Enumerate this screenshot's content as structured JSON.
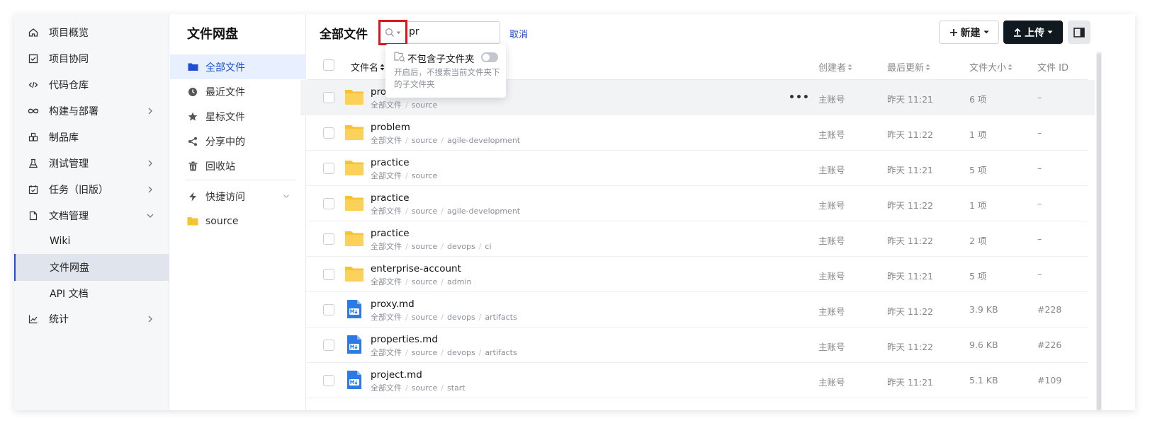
{
  "nav": {
    "items": [
      {
        "label": "项目概览",
        "icon": "home-icon"
      },
      {
        "label": "项目协同",
        "icon": "checkbox-icon"
      },
      {
        "label": "代码仓库",
        "icon": "code-icon"
      },
      {
        "label": "构建与部署",
        "icon": "infinity-icon",
        "has_children": true
      },
      {
        "label": "制品库",
        "icon": "package-icon"
      },
      {
        "label": "测试管理",
        "icon": "flask-icon",
        "has_children": true
      },
      {
        "label": "任务（旧版）",
        "icon": "calendar-check-icon",
        "has_children": true
      },
      {
        "label": "文档管理",
        "icon": "document-icon",
        "expanded": true
      },
      {
        "label": "Wiki",
        "sub": true
      },
      {
        "label": "文件网盘",
        "sub": true,
        "active": true
      },
      {
        "label": "API 文档",
        "sub": true
      },
      {
        "label": "统计",
        "icon": "chart-icon",
        "has_children": true
      }
    ]
  },
  "file_panel": {
    "title": "文件网盘",
    "items": [
      {
        "label": "全部文件",
        "icon": "folder-icon",
        "active": true
      },
      {
        "label": "最近文件",
        "icon": "clock-icon"
      },
      {
        "label": "星标文件",
        "icon": "star-icon"
      },
      {
        "label": "分享中的",
        "icon": "share-icon"
      },
      {
        "label": "回收站",
        "icon": "trash-icon"
      }
    ],
    "quick_access_label": "快捷访问",
    "quick_items": [
      {
        "label": "source",
        "icon": "folder-icon"
      }
    ]
  },
  "main": {
    "title": "全部文件",
    "search_value": "pr",
    "cancel_label": "取消",
    "new_label": "新建",
    "upload_label": "上传"
  },
  "popover": {
    "label": "不包含子文件夹",
    "description": "开启后，不搜索当前文件夹下的子文件夹",
    "toggle_on": false
  },
  "table": {
    "columns": {
      "name": "文件名",
      "creator": "创建者",
      "updated": "最后更新",
      "size": "文件大小",
      "id": "文件 ID"
    },
    "rows": [
      {
        "name": "pro",
        "type": "folder",
        "path": [
          "全部文件",
          "source"
        ],
        "creator": "主账号",
        "updated": "昨天 11:21",
        "size": "6 项",
        "id": "–",
        "hover": true
      },
      {
        "name": "problem",
        "type": "folder",
        "path": [
          "全部文件",
          "source",
          "agile-development"
        ],
        "creator": "主账号",
        "updated": "昨天 11:22",
        "size": "1 项",
        "id": "–"
      },
      {
        "name": "practice",
        "type": "folder",
        "path": [
          "全部文件",
          "source"
        ],
        "creator": "主账号",
        "updated": "昨天 11:21",
        "size": "5 项",
        "id": "–"
      },
      {
        "name": "practice",
        "type": "folder",
        "path": [
          "全部文件",
          "source",
          "agile-development"
        ],
        "creator": "主账号",
        "updated": "昨天 11:22",
        "size": "1 项",
        "id": "–"
      },
      {
        "name": "practice",
        "type": "folder",
        "path": [
          "全部文件",
          "source",
          "devops",
          "ci"
        ],
        "creator": "主账号",
        "updated": "昨天 11:22",
        "size": "2 项",
        "id": "–"
      },
      {
        "name": "enterprise-account",
        "type": "folder",
        "path": [
          "全部文件",
          "source",
          "admin"
        ],
        "creator": "主账号",
        "updated": "昨天 11:21",
        "size": "5 项",
        "id": "–"
      },
      {
        "name": "proxy.md",
        "type": "markdown",
        "path": [
          "全部文件",
          "source",
          "devops",
          "artifacts"
        ],
        "creator": "主账号",
        "updated": "昨天 11:22",
        "size": "3.9 KB",
        "id": "#228"
      },
      {
        "name": "properties.md",
        "type": "markdown",
        "path": [
          "全部文件",
          "source",
          "devops",
          "artifacts"
        ],
        "creator": "主账号",
        "updated": "昨天 11:22",
        "size": "9.6 KB",
        "id": "#226"
      },
      {
        "name": "project.md",
        "type": "markdown",
        "path": [
          "全部文件",
          "source",
          "start"
        ],
        "creator": "主账号",
        "updated": "昨天 11:21",
        "size": "5.1 KB",
        "id": "#109"
      }
    ]
  },
  "colors": {
    "accent": "#1a4fd6",
    "folder": "#f7c234",
    "markdown": "#2c7be5",
    "highlight_border": "#e0141e",
    "upload_bg": "#101820"
  }
}
